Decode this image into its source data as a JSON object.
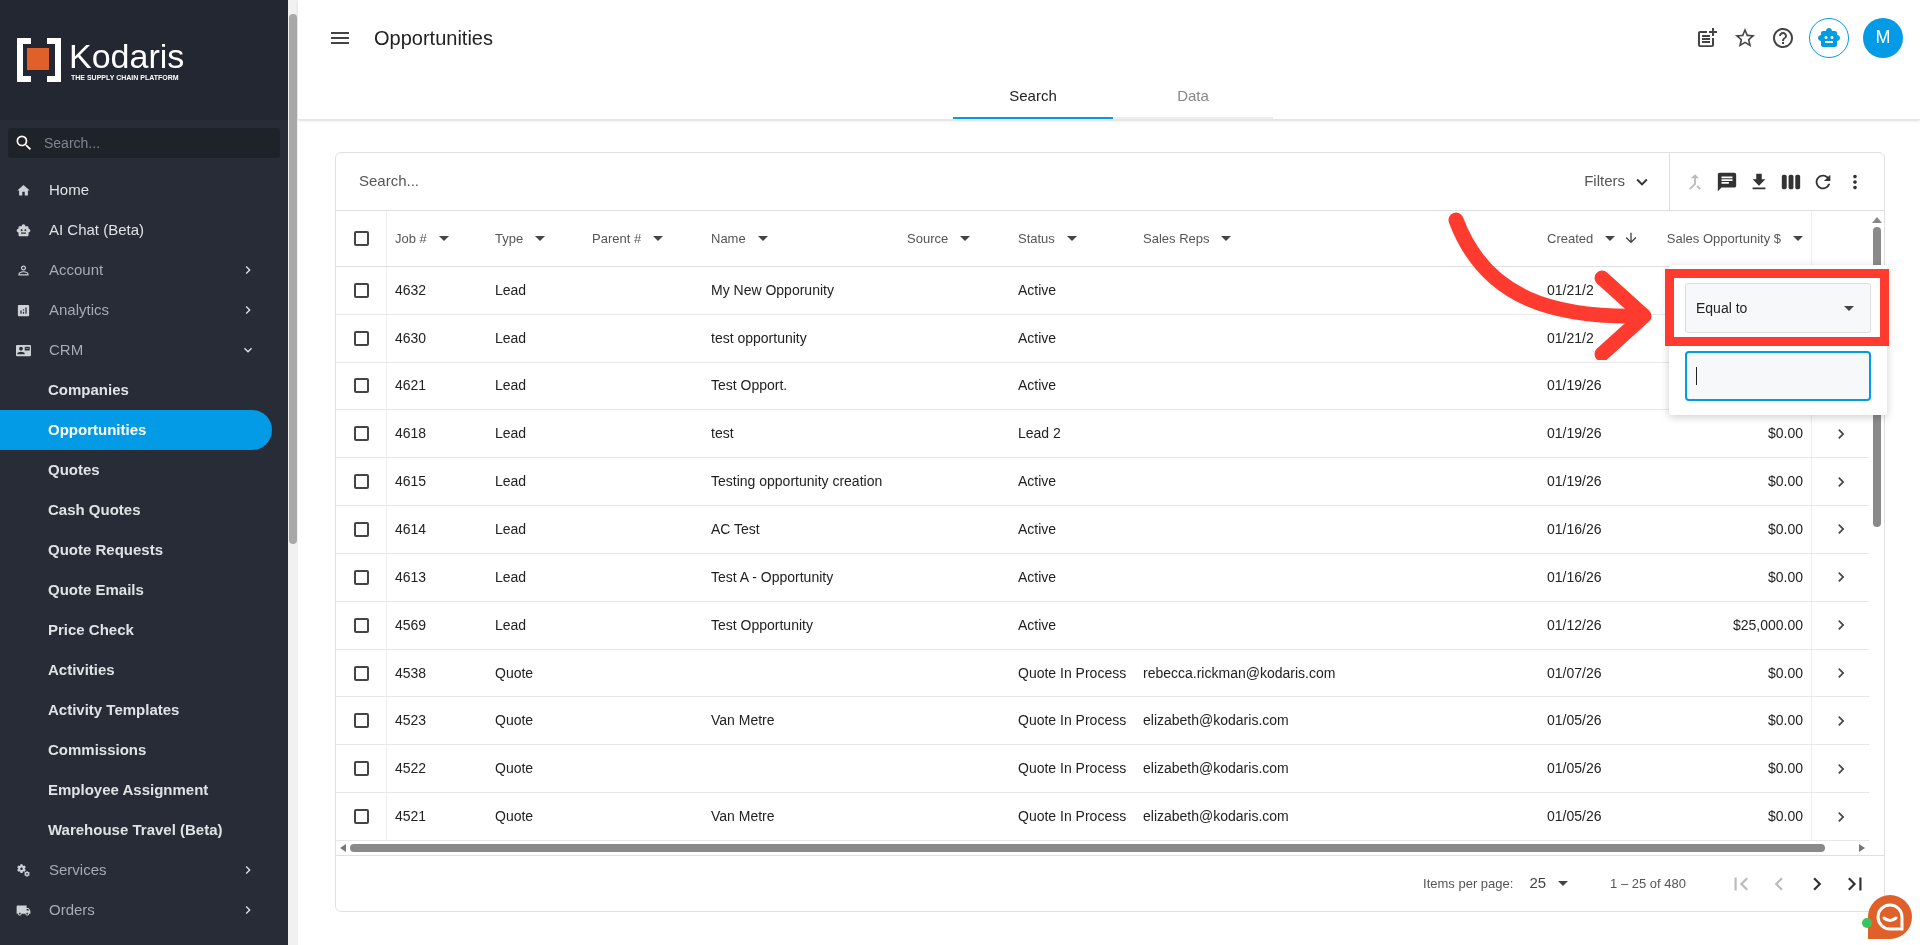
{
  "logo": {
    "name": "Kodaris",
    "tagline": "THE SUPPLY CHAIN PLATFORM"
  },
  "sidebar": {
    "search": {
      "placeholder": "Search..."
    },
    "items": [
      {
        "label": "Home",
        "kind": "link",
        "selected": false
      },
      {
        "label": "AI Chat (Beta)",
        "kind": "link",
        "selected": false
      },
      {
        "label": "Account",
        "kind": "group",
        "selected": false,
        "expanded": false
      },
      {
        "label": "Analytics",
        "kind": "group",
        "selected": false,
        "expanded": false
      },
      {
        "label": "CRM",
        "kind": "group",
        "selected": false,
        "expanded": true,
        "children": [
          {
            "label": "Companies",
            "selected": false
          },
          {
            "label": "Opportunities",
            "selected": true
          },
          {
            "label": "Quotes",
            "selected": false
          },
          {
            "label": "Cash Quotes",
            "selected": false
          },
          {
            "label": "Quote Requests",
            "selected": false
          },
          {
            "label": "Quote Emails",
            "selected": false
          },
          {
            "label": "Price Check",
            "selected": false
          },
          {
            "label": "Activities",
            "selected": false
          },
          {
            "label": "Activity Templates",
            "selected": false
          },
          {
            "label": "Commissions",
            "selected": false
          },
          {
            "label": "Employee Assignment",
            "selected": false
          },
          {
            "label": "Warehouse Travel (Beta)",
            "selected": false
          }
        ]
      },
      {
        "label": "Services",
        "kind": "group",
        "selected": false,
        "expanded": false
      },
      {
        "label": "Orders",
        "kind": "group",
        "selected": false,
        "expanded": false
      }
    ]
  },
  "header": {
    "title": "Opportunities",
    "avatar": "M"
  },
  "tabs": [
    {
      "label": "Search",
      "selected": true
    },
    {
      "label": "Data",
      "selected": false
    }
  ],
  "table": {
    "search": {
      "placeholder": "Search..."
    },
    "filters": "Filters",
    "toolbar": [
      {
        "kind": "merge",
        "disabled": true
      },
      {
        "kind": "comment",
        "disabled": false
      },
      {
        "kind": "download",
        "disabled": false
      },
      {
        "kind": "columns",
        "disabled": false
      },
      {
        "kind": "refresh",
        "disabled": false
      },
      {
        "kind": "more",
        "disabled": false
      }
    ],
    "all_checked": false,
    "columns": [
      {
        "label": "Job #"
      },
      {
        "label": "Type"
      },
      {
        "label": "Parent #"
      },
      {
        "label": "Name"
      },
      {
        "label": "Source"
      },
      {
        "label": "Status"
      },
      {
        "label": "Sales Reps"
      },
      {
        "label": "Created",
        "sorted_descending": true
      },
      {
        "label": "Sales Opportunity $"
      }
    ],
    "rows": [
      {
        "job": "4632",
        "type": "Lead",
        "name": "My New Opporunity",
        "status": "Active",
        "created": "01/21/2",
        "checked": false
      },
      {
        "job": "4630",
        "type": "Lead",
        "name": "test opportunity",
        "status": "Active",
        "created": "01/21/2",
        "checked": false
      },
      {
        "job": "4621",
        "type": "Lead",
        "name": "Test Opport.",
        "status": "Active",
        "created": "01/19/26",
        "checked": false
      },
      {
        "job": "4618",
        "type": "Lead",
        "name": "test",
        "status": "Lead 2",
        "created": "01/19/26",
        "amount": "$0.00",
        "checked": false
      },
      {
        "job": "4615",
        "type": "Lead",
        "name": "Testing opportunity creation",
        "status": "Active",
        "created": "01/19/26",
        "amount": "$0.00",
        "checked": false
      },
      {
        "job": "4614",
        "type": "Lead",
        "name": "AC Test",
        "status": "Active",
        "created": "01/16/26",
        "amount": "$0.00",
        "checked": false
      },
      {
        "job": "4613",
        "type": "Lead",
        "name": "Test A - Opportunity",
        "status": "Active",
        "created": "01/16/26",
        "amount": "$0.00",
        "checked": false
      },
      {
        "job": "4569",
        "type": "Lead",
        "name": "Test Opportunity",
        "status": "Active",
        "created": "01/12/26",
        "amount": "$25,000.00",
        "checked": false
      },
      {
        "job": "4538",
        "type": "Quote",
        "status": "Quote In Process",
        "reps": "rebecca.rickman@kodaris.com",
        "created": "01/07/26",
        "amount": "$0.00",
        "checked": false
      },
      {
        "job": "4523",
        "type": "Quote",
        "name": "Van Metre",
        "status": "Quote In Process",
        "reps": "elizabeth@kodaris.com",
        "created": "01/05/26",
        "amount": "$0.00",
        "checked": false
      },
      {
        "job": "4522",
        "type": "Quote",
        "status": "Quote In Process",
        "reps": "elizabeth@kodaris.com",
        "created": "01/05/26",
        "amount": "$0.00",
        "checked": false
      },
      {
        "job": "4521",
        "type": "Quote",
        "name": "Van Metre",
        "status": "Quote In Process",
        "reps": "elizabeth@kodaris.com",
        "created": "01/05/26",
        "amount": "$0.00",
        "checked": false
      }
    ],
    "pagination": {
      "label": "Items per page:",
      "size": "25",
      "range": "1 – 25 of 480",
      "buttons": [
        {
          "kind": "first",
          "disabled": true
        },
        {
          "kind": "prev",
          "disabled": true
        },
        {
          "kind": "next",
          "disabled": false
        },
        {
          "kind": "last",
          "disabled": false
        }
      ]
    }
  },
  "filter_popup": {
    "operator": "Equal to",
    "value_focused": true
  }
}
